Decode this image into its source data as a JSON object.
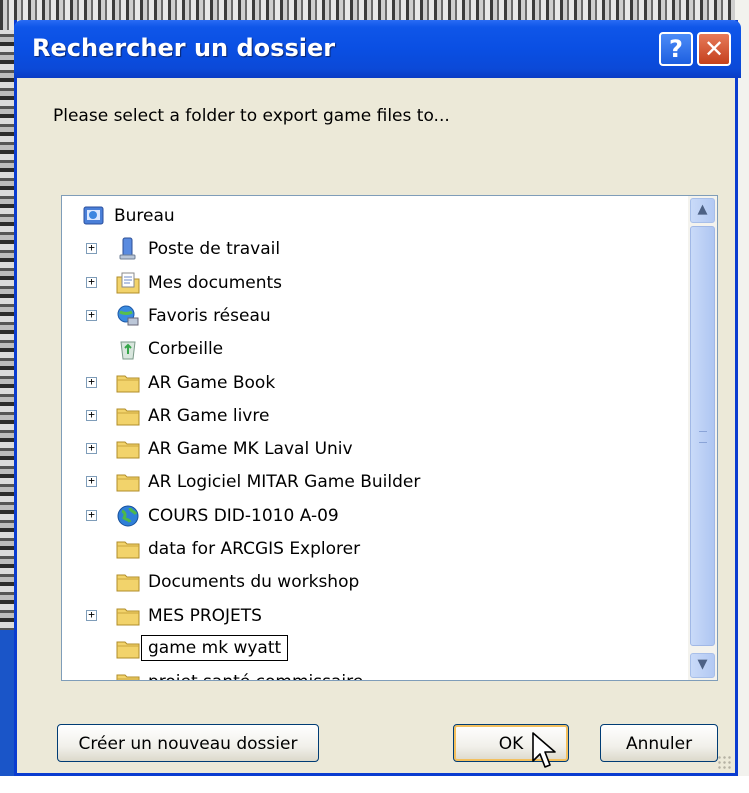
{
  "window": {
    "title": "Rechercher un dossier",
    "help_label": "?",
    "close_label": "✕"
  },
  "instruction": "Please select a folder to export game files to...",
  "tree": {
    "items": [
      {
        "label": "Bureau",
        "icon": "desktop-icon",
        "expandable": false,
        "level": 0
      },
      {
        "label": "Poste de travail",
        "icon": "computer-icon",
        "expandable": true,
        "level": 1
      },
      {
        "label": "Mes documents",
        "icon": "documents-folder-icon",
        "expandable": true,
        "level": 1
      },
      {
        "label": "Favoris réseau",
        "icon": "network-icon",
        "expandable": true,
        "level": 1
      },
      {
        "label": "Corbeille",
        "icon": "recycle-bin-icon",
        "expandable": false,
        "level": 1
      },
      {
        "label": "AR Game Book",
        "icon": "folder-icon",
        "expandable": true,
        "level": 1
      },
      {
        "label": "AR Game livre",
        "icon": "folder-icon",
        "expandable": true,
        "level": 1
      },
      {
        "label": "AR Game MK Laval Univ",
        "icon": "folder-icon",
        "expandable": true,
        "level": 1
      },
      {
        "label": "AR Logiciel MITAR Game Builder",
        "icon": "folder-icon",
        "expandable": true,
        "level": 1
      },
      {
        "label": "COURS DID-1010 A-09",
        "icon": "globe-icon",
        "expandable": true,
        "level": 1
      },
      {
        "label": "data for ARCGIS Explorer",
        "icon": "folder-icon",
        "expandable": false,
        "level": 1
      },
      {
        "label": "Documents du workshop",
        "icon": "folder-icon",
        "expandable": false,
        "level": 1
      },
      {
        "label": "MES PROJETS",
        "icon": "folder-icon",
        "expandable": true,
        "level": 1
      },
      {
        "label": "game mk wyatt",
        "icon": "folder-icon",
        "expandable": false,
        "level": 1,
        "editing": true
      },
      {
        "label": "projet santé commissaire",
        "icon": "folder-icon",
        "expandable": false,
        "level": 1
      }
    ]
  },
  "buttons": {
    "new_folder": "Créer un nouveau dossier",
    "ok": "OK",
    "cancel": "Annuler"
  },
  "colors": {
    "titlebar": "#0a4fe3",
    "folder": "#f2d36b",
    "close": "#c4401c"
  }
}
